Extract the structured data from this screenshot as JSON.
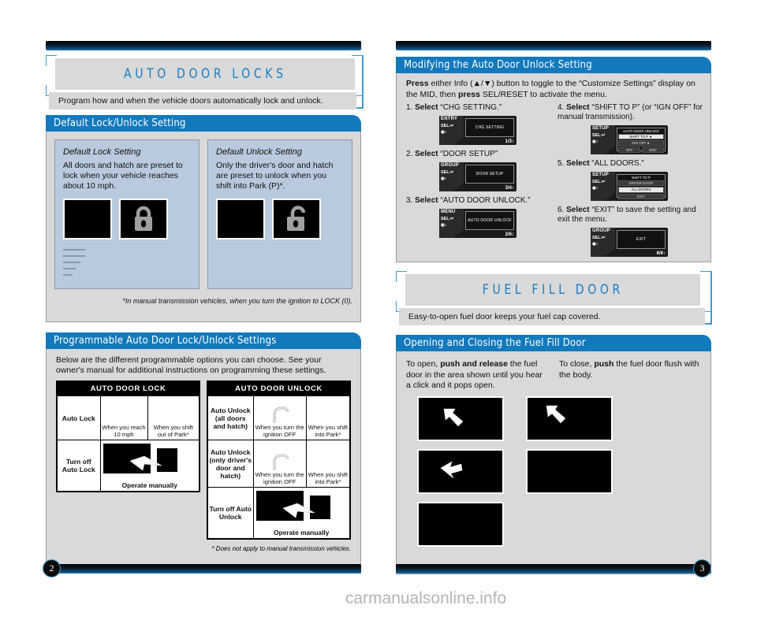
{
  "left_page": {
    "page_number": "2",
    "title": "AUTO DOOR LOCKS",
    "subtitle": "Program how and when the vehicle doors automatically lock and unlock.",
    "default_section": {
      "heading": "Default Lock/Unlock Setting",
      "cards": [
        {
          "title": "Default Lock Setting",
          "text": "All doors and hatch are preset to lock when your vehicle reaches about 10 mph.",
          "icon": "closed-padlock-icon"
        },
        {
          "title": "Default Unlock Setting",
          "text": "Only the driver's door and hatch are preset to unlock when you shift into Park (P)*.",
          "icon": "open-padlock-icon"
        }
      ],
      "footnote": "*In manual transmission vehicles, when you turn the ignition to LOCK (0)."
    },
    "programmable_section": {
      "heading": "Programmable Auto Door Lock/Unlock Settings",
      "intro": "Below are the different programmable options you can choose. See your owner's manual for additional instructions on programming these settings.",
      "lock_table": {
        "header": "AUTO DOOR LOCK",
        "rows": [
          {
            "label": "Auto Lock",
            "cells": [
              "When you reach 10 mph",
              "When you shift out of Park*"
            ]
          },
          {
            "label": "Turn off Auto Lock",
            "caption": "Operate manually"
          }
        ]
      },
      "unlock_table": {
        "header": "AUTO DOOR UNLOCK",
        "rows": [
          {
            "label": "Auto Unlock (all doors and hatch)",
            "cells": [
              "When you turn the ignition OFF",
              "When you shift into Park*"
            ]
          },
          {
            "label": "Auto Unlock (only driver's door and hatch)",
            "cells": [
              "When you turn the ignition OFF",
              "When you shift into Park*"
            ]
          },
          {
            "label": "Turn off Auto Unlock",
            "caption": "Operate manually"
          }
        ]
      },
      "footnote": "* Does not apply to manual transmission vehicles."
    }
  },
  "right_page": {
    "page_number": "3",
    "modify_section": {
      "heading": "Modifying the Auto Door Unlock Setting",
      "intro_bold": "Press",
      "intro_rest": " either Info (▲/▼) button to toggle to the “Customize Settings” display on the MID, then ",
      "intro_bold2": "press",
      "intro_rest2": " SEL/RESET to activate the menu.",
      "steps": [
        {
          "num": "1.",
          "bold": "Select",
          "text": " “CHG SETTING.”",
          "mid": {
            "top_label": "ENTRY",
            "sel_label": "SEL:",
            "ud_label": "↕",
            "screen": "CHG SETTING",
            "page": "1/3↕"
          }
        },
        {
          "num": "2.",
          "bold": "Select",
          "text": " “DOOR SETUP”",
          "mid": {
            "top_label": "GROUP",
            "sel_label": "SEL:",
            "ud_label": "↕",
            "screen": "DOOR SETUP",
            "page": "3/4↕"
          }
        },
        {
          "num": "3.",
          "bold": "Select",
          "text": " “AUTO DOOR UNLOCK.”",
          "mid": {
            "top_label": "MENU",
            "sel_label": "SEL:",
            "ud_label": "↕",
            "screen": "AUTO DOOR UNLOCK",
            "page": "2/6↕"
          }
        },
        {
          "num": "4.",
          "bold": "Select",
          "text": " “SHIFT TO P” (or “IGN OFF” for manual transmission).",
          "mid": {
            "top_label": "SETUP",
            "sel_label": "SEL:",
            "ud_label": "↕",
            "screen_header": "AUTO DOOR UNLOCK",
            "options": [
              "SHIFT TO P  ►",
              "IGN OFF  ►"
            ],
            "options_pair": [
              "OFF",
              "END"
            ],
            "page": ""
          }
        },
        {
          "num": "5.",
          "bold": "Select",
          "text": " “ALL DOORS.”",
          "mid": {
            "top_label": "SETUP",
            "sel_label": "SEL:",
            "ud_label": "↕",
            "screen_header": "SHIFT TO P",
            "options": [
              "DRIVER DOOR",
              "ALL DOORS",
              "EXIT"
            ],
            "page": ""
          }
        },
        {
          "num": "6.",
          "bold": "Select",
          "text": " “EXIT” to save the setting and exit the menu.",
          "mid": {
            "top_label": "GROUP",
            "sel_label": "SEL:",
            "ud_label": "↕",
            "screen": "EXIT",
            "page": "6/6↕"
          }
        }
      ]
    },
    "fuel_title": "FUEL FILL DOOR",
    "fuel_subtitle": "Easy-to-open fuel door keeps your fuel cap covered.",
    "fuel_section": {
      "heading": "Opening and Closing the Fuel Fill Door",
      "open_text_a": "To open, ",
      "open_text_b": "push and release",
      "open_text_c": " the fuel door in the area shown until you hear a click and it pops open.",
      "close_text_a": "To close, ",
      "close_text_b": "push",
      "close_text_c": " the fuel door flush with the body."
    }
  },
  "watermark": "carmanualsonline.info",
  "colors": {
    "accent_blue": "#1379bd",
    "title_blue": "#1a7dc4",
    "bracket_blue": "#3d9ad4",
    "plate_gray": "#d9d9d9",
    "card_blue": "#b9c9de"
  }
}
